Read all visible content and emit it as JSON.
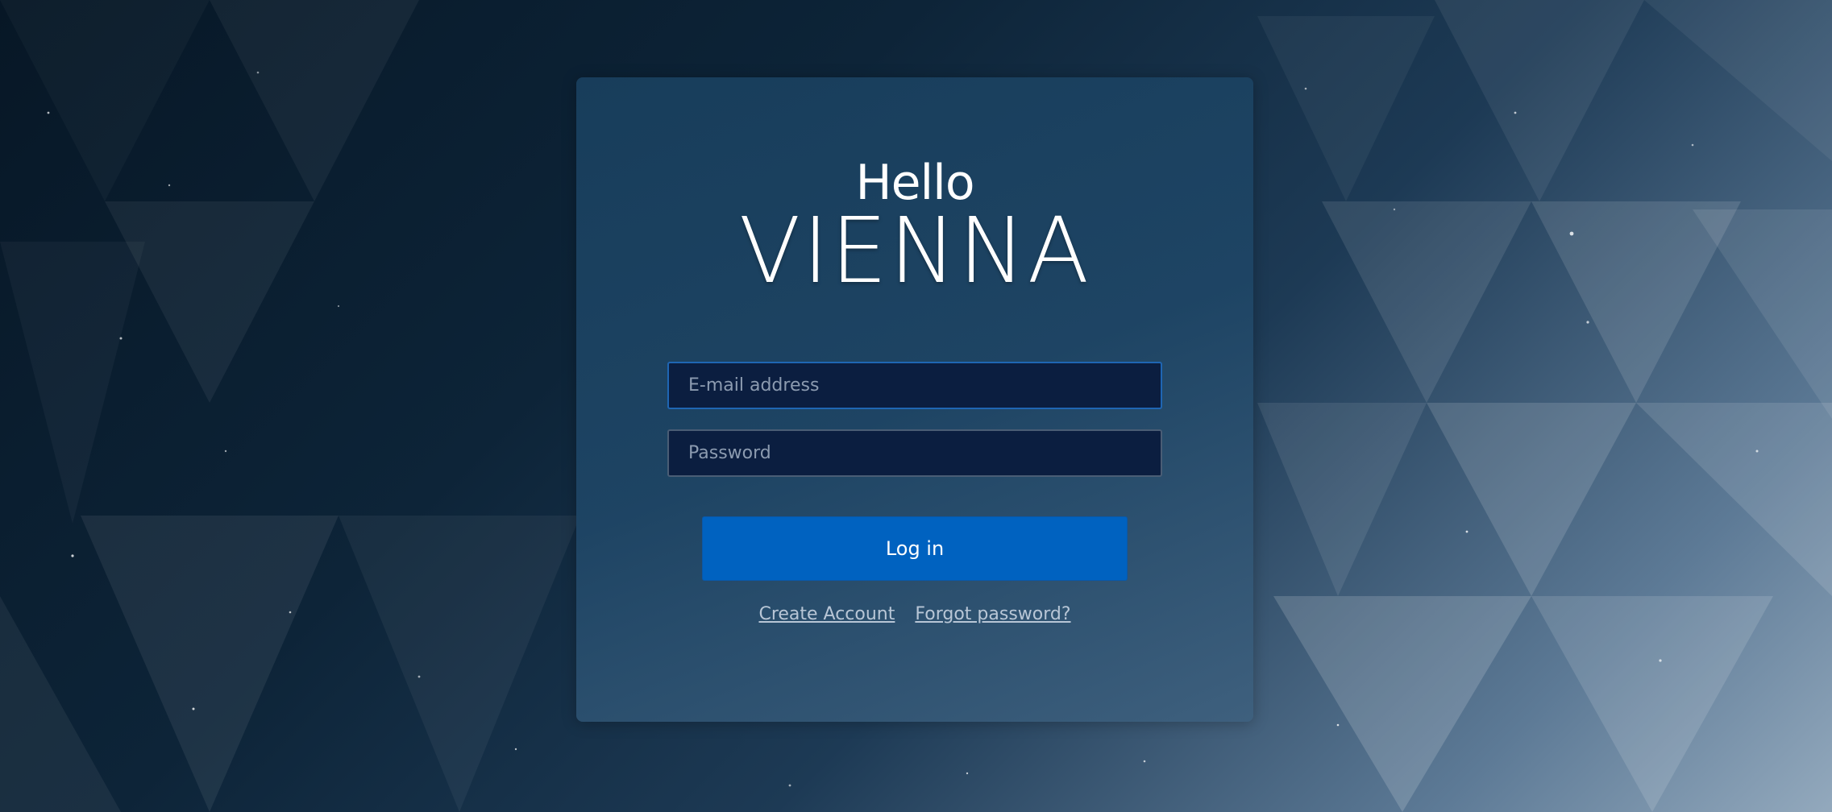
{
  "brand": {
    "greeting": "Hello",
    "city": "VIENNA"
  },
  "form": {
    "email_placeholder": "E-mail address",
    "email_value": "",
    "password_placeholder": "Password",
    "password_value": "",
    "login_label": "Log in"
  },
  "links": {
    "create_account": "Create Account",
    "forgot_password": "Forgot password?"
  },
  "colors": {
    "accent": "#0062c0",
    "input_background": "#0b1e40",
    "card_background": "#1e4565",
    "link_color": "#b8c6d6"
  }
}
